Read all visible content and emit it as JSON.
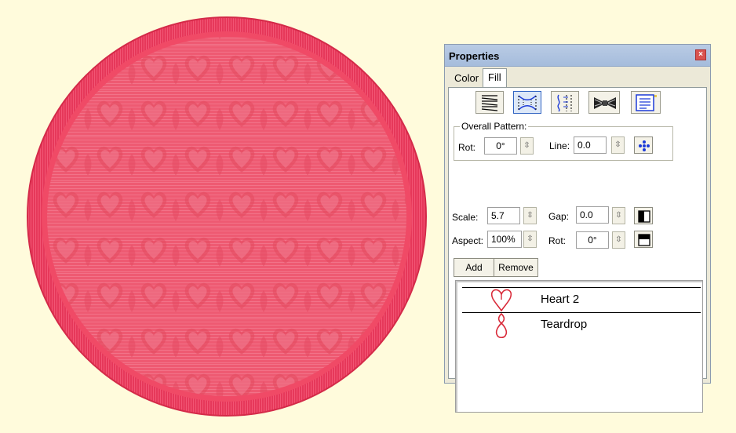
{
  "canvas": {
    "shape": "circular embroidered patch with satin border and heart pattern fill",
    "fill_color": "#ee5a72",
    "border_color": "#e0334f",
    "background_color": "#fffbdc"
  },
  "panel": {
    "title": "Properties",
    "close_glyph": "×",
    "tabs": [
      {
        "label": "Color",
        "active": false
      },
      {
        "label": "Fill",
        "active": true
      }
    ],
    "fill_type_buttons": [
      {
        "icon": "satin-fill-icon",
        "selected": false
      },
      {
        "icon": "pattern-fill-icon",
        "selected": true
      },
      {
        "icon": "contour-fill-icon",
        "selected": false
      },
      {
        "icon": "motif-fill-icon",
        "selected": false
      },
      {
        "icon": "text-fill-icon",
        "selected": false
      }
    ],
    "overall_pattern": {
      "label": "Overall Pattern:",
      "rot_label": "Rot:",
      "rot_value": "0°",
      "line_label": "Line:",
      "line_value": "0.0"
    },
    "scale_label": "Scale:",
    "scale_value": "5.7",
    "gap_label": "Gap:",
    "gap_value": "0.0",
    "aspect_label": "Aspect:",
    "aspect_value": "100%",
    "rot2_label": "Rot:",
    "rot2_value": "0°",
    "spin_glyph": "⇳",
    "add_label": "Add",
    "remove_label": "Remove",
    "motifs": [
      {
        "name": "Heart 2",
        "icon": "heart-icon"
      },
      {
        "name": "Teardrop",
        "icon": "teardrop-icon"
      }
    ]
  }
}
